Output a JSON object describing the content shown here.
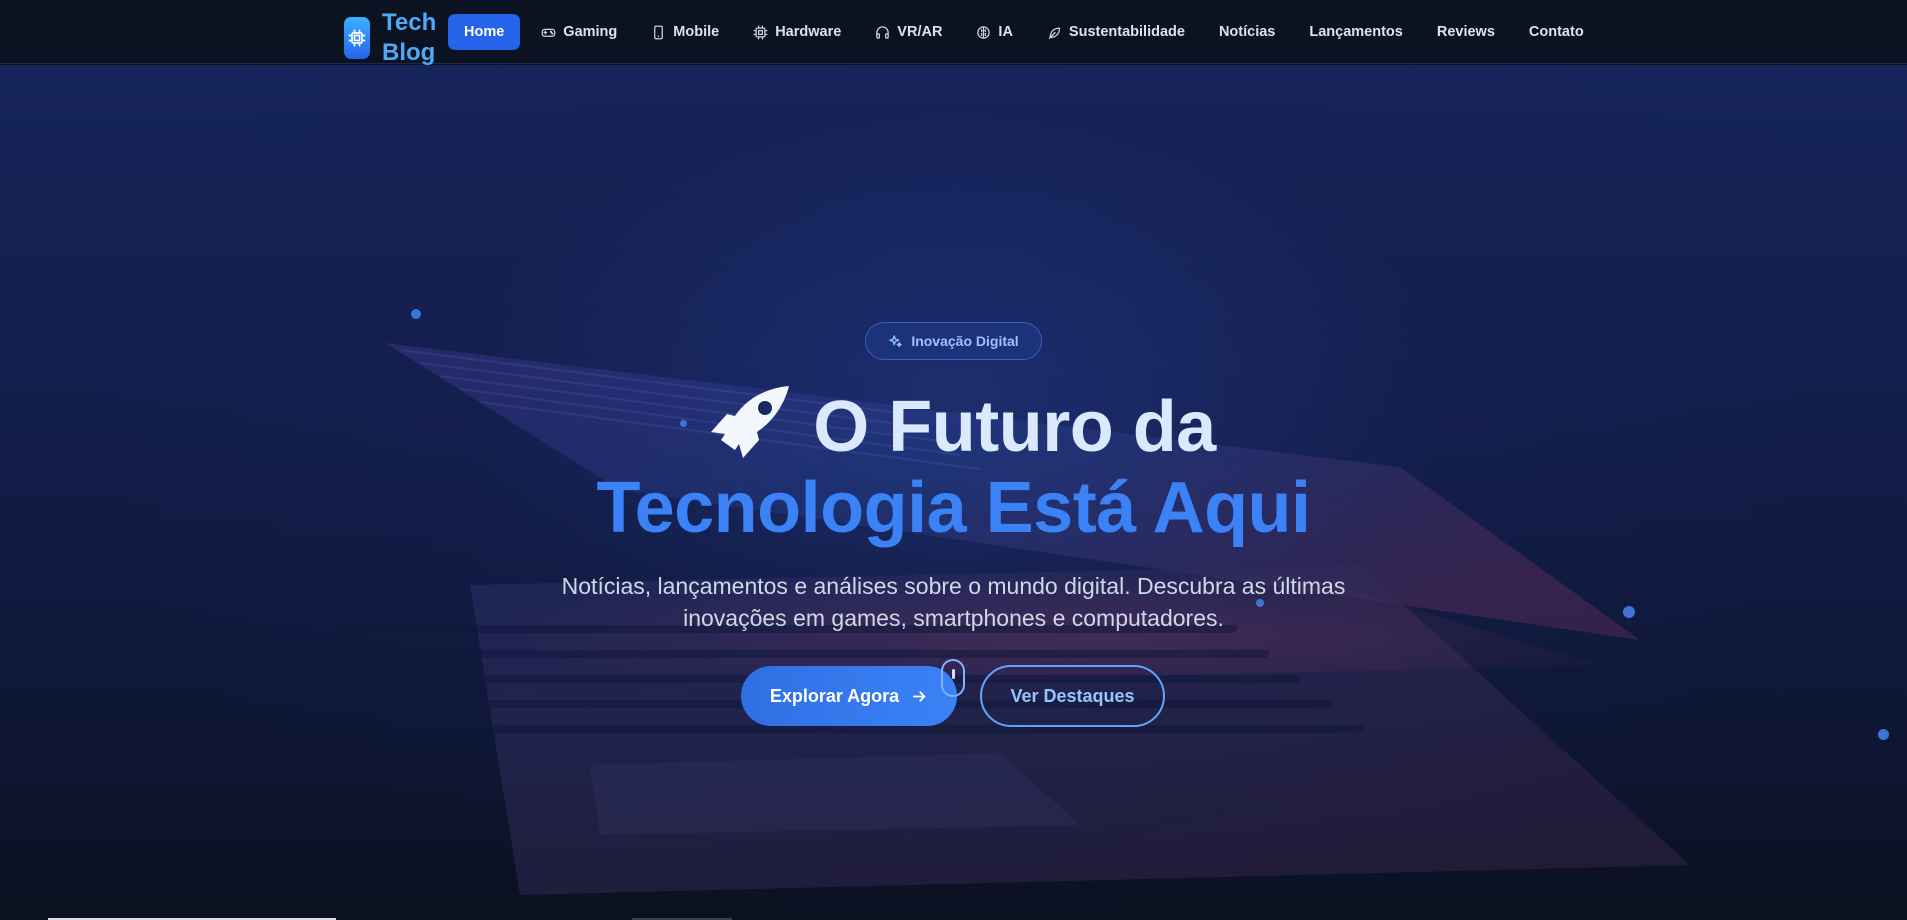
{
  "brand": {
    "line1": "Tech",
    "line2": "Blog",
    "logo_icon": "cpu-chip-icon"
  },
  "nav": {
    "items": [
      {
        "label": "Home",
        "icon": null,
        "active": true
      },
      {
        "label": "Gaming",
        "icon": "gamepad-icon"
      },
      {
        "label": "Mobile",
        "icon": "smartphone-icon"
      },
      {
        "label": "Hardware",
        "icon": "cpu-icon"
      },
      {
        "label": "VR/AR",
        "icon": "headphones-icon"
      },
      {
        "label": "IA",
        "icon": "brain-icon"
      },
      {
        "label": "Sustentabilidade",
        "icon": "leaf-icon"
      },
      {
        "label": "Notícias",
        "icon": null
      },
      {
        "label": "Lançamentos",
        "icon": null
      },
      {
        "label": "Reviews",
        "icon": null
      },
      {
        "label": "Contato",
        "icon": null
      }
    ]
  },
  "hero": {
    "badge": "Inovação Digital",
    "title_line1": "O Futuro da",
    "title_line2": "Tecnologia Está Aqui",
    "subtitle": "Notícias, lançamentos e análises sobre o mundo digital. Descubra as últimas inovações em games, smartphones e computadores.",
    "primary_button": "Explorar Agora",
    "secondary_button": "Ver Destaques"
  },
  "colors": {
    "accent": "#2563eb",
    "title_highlight": "#3b82f6",
    "background": "#0b1120"
  }
}
